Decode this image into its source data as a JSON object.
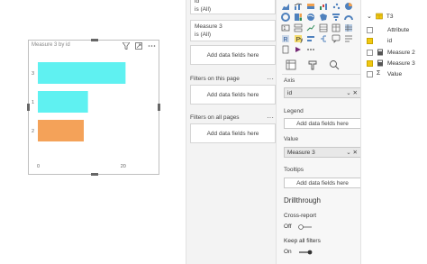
{
  "visual": {
    "title": "Measure 3 by id"
  },
  "chart_data": {
    "type": "bar",
    "orientation": "horizontal",
    "categories": [
      "3",
      "1",
      "2"
    ],
    "series": [
      {
        "values": [
          21,
          12,
          11
        ]
      }
    ],
    "colors": [
      "#5ff1f1",
      "#5ff1f1",
      "#f4a259"
    ],
    "x_ticks": [
      "0",
      "20"
    ],
    "xlim": [
      0,
      22
    ],
    "title": "Measure 3 by id",
    "xlabel": "",
    "ylabel": ""
  },
  "filters": {
    "top_card": {
      "field": "id",
      "state": "is (All)"
    },
    "measure_card": {
      "field": "Measure 3",
      "state": "is (All)"
    },
    "add_label": "Add data fields here",
    "on_this_page": {
      "title": "Filters on this page",
      "add_label": "Add data fields here",
      "more": "···"
    },
    "on_all_pages": {
      "title": "Filters on all pages",
      "add_label": "Add data fields here",
      "more": "···"
    }
  },
  "viz": {
    "more_glyph": "···",
    "axis": {
      "label": "Axis",
      "value": "id",
      "controls": "⌄ ✕"
    },
    "legend": {
      "label": "Legend",
      "placeholder": "Add data fields here"
    },
    "value": {
      "label": "Value",
      "value": "Measure 3",
      "controls": "⌄ ✕"
    },
    "tooltips": {
      "label": "Tooltips",
      "placeholder": "Add data fields here"
    },
    "drillthrough": {
      "title": "Drillthrough",
      "cross_report": {
        "label": "Cross-report",
        "state": "Off"
      },
      "keep_filters": {
        "label": "Keep all filters",
        "state": "On"
      }
    }
  },
  "fields": {
    "table": {
      "name": "T3",
      "icon": "table-icon"
    },
    "items": [
      {
        "name": "Attribute",
        "checked": false,
        "icon": "none"
      },
      {
        "name": "id",
        "checked": true,
        "icon": "none"
      },
      {
        "name": "Measure 2",
        "checked": false,
        "icon": "calculator-icon"
      },
      {
        "name": "Measure 3",
        "checked": true,
        "icon": "calculator-icon"
      },
      {
        "name": "Value",
        "checked": false,
        "icon": "sigma-icon"
      }
    ],
    "sigma": "Σ"
  },
  "colors": {
    "accent_yellow": "#f2c811",
    "bar_cyan": "#5ff1f1",
    "bar_orange": "#f4a259"
  }
}
